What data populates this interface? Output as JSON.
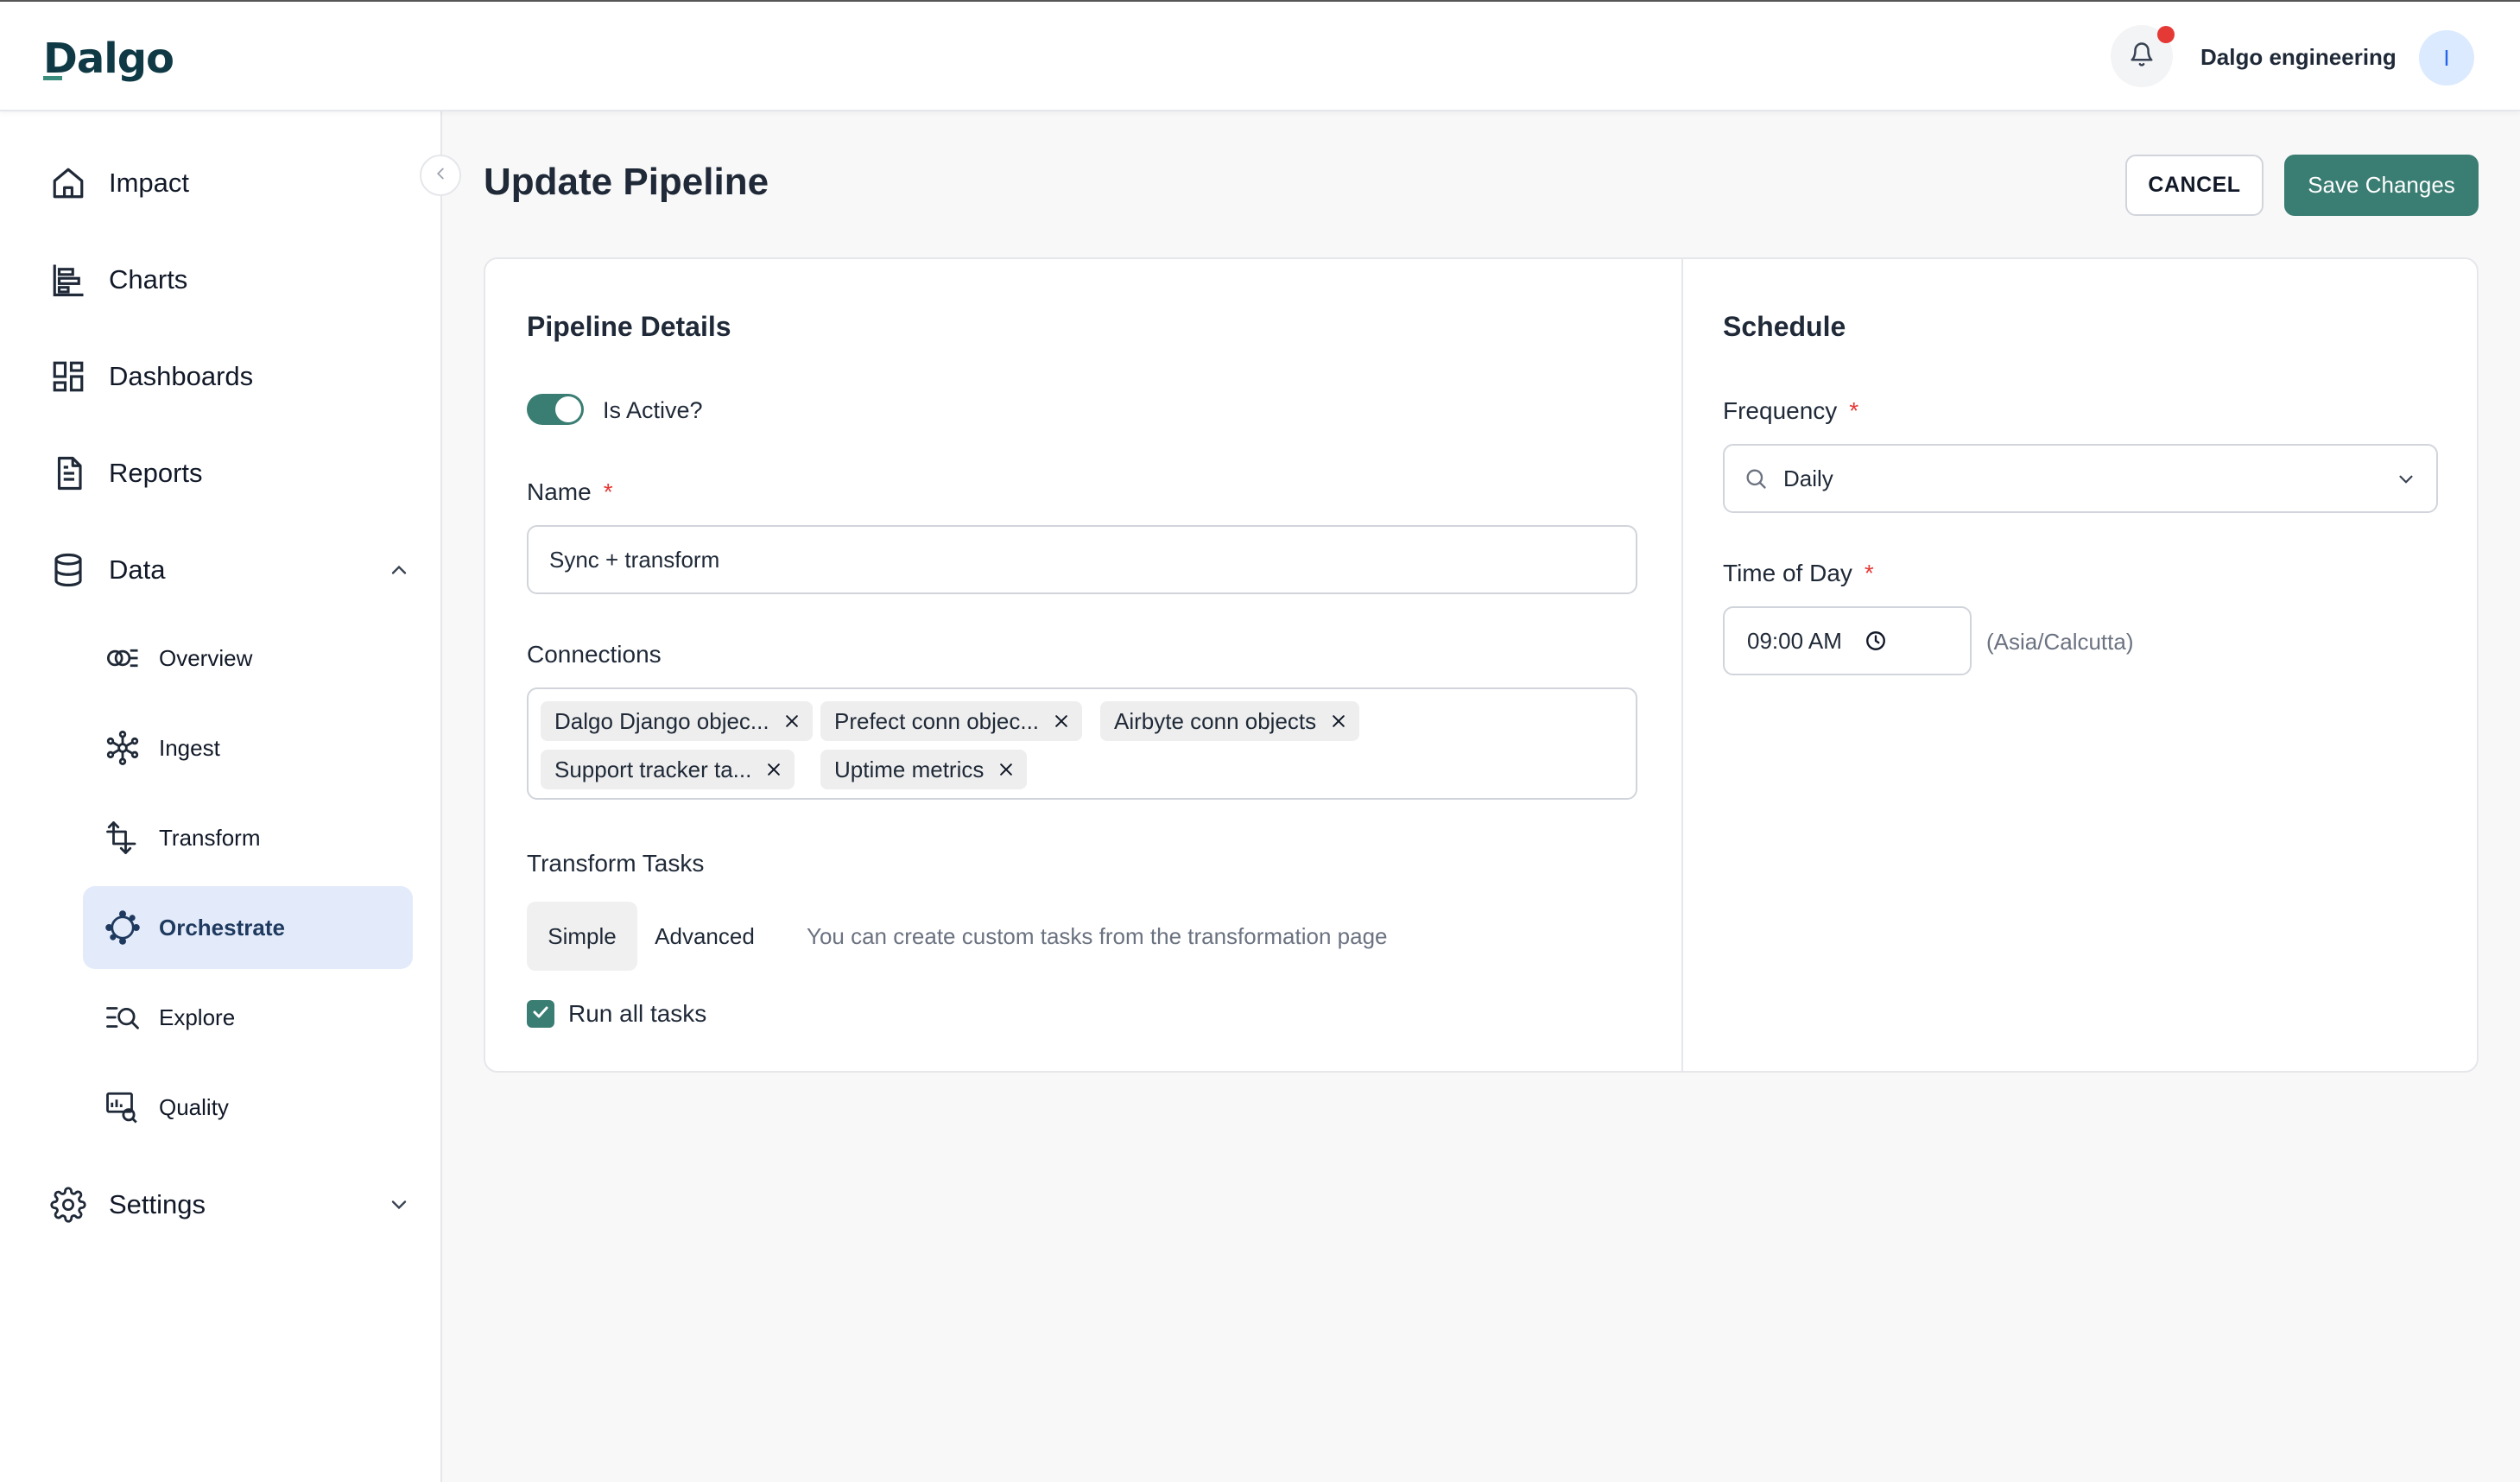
{
  "header": {
    "logo": "Dalgo",
    "org_name": "Dalgo engineering",
    "avatar_initial": "I",
    "icons": {
      "notifications": "bell-icon"
    }
  },
  "sidebar": {
    "items": [
      {
        "label": "Impact",
        "icon": "home-icon"
      },
      {
        "label": "Charts",
        "icon": "bar-chart-icon"
      },
      {
        "label": "Dashboards",
        "icon": "dashboard-grid-icon"
      },
      {
        "label": "Reports",
        "icon": "document-icon"
      },
      {
        "label": "Data",
        "icon": "database-icon",
        "expanded": true
      },
      {
        "label": "Settings",
        "icon": "gear-icon",
        "expanded": false
      }
    ],
    "data_subitems": [
      {
        "label": "Overview",
        "icon": "overview-icon"
      },
      {
        "label": "Ingest",
        "icon": "ingest-icon"
      },
      {
        "label": "Transform",
        "icon": "transform-icon"
      },
      {
        "label": "Orchestrate",
        "icon": "orchestrate-icon",
        "active": true
      },
      {
        "label": "Explore",
        "icon": "explore-icon"
      },
      {
        "label": "Quality",
        "icon": "quality-icon"
      }
    ]
  },
  "page": {
    "title": "Update Pipeline",
    "cancel_label": "CANCEL",
    "save_label": "Save Changes"
  },
  "pipeline_details": {
    "title": "Pipeline Details",
    "is_active_label": "Is Active?",
    "is_active": true,
    "name_label": "Name",
    "required_mark": "*",
    "name_value": "Sync + transform",
    "connections_label": "Connections",
    "connections": [
      "Dalgo Django objec...",
      "Prefect conn objec...",
      "Airbyte conn objects",
      "Support tracker ta...",
      "Uptime metrics"
    ],
    "transform_tasks_label": "Transform Tasks",
    "tabs": [
      "Simple",
      "Advanced"
    ],
    "active_tab": "Simple",
    "hint": "You can create custom tasks from the transformation page",
    "run_all_label": "Run all tasks",
    "run_all_checked": true
  },
  "schedule": {
    "title": "Schedule",
    "frequency_label": "Frequency",
    "frequency_value": "Daily",
    "time_label": "Time of Day",
    "time_value": "09:00 AM",
    "timezone": "(Asia/Calcutta)"
  },
  "colors": {
    "primary": "#3a7d73",
    "active_nav_bg": "#e3ebfb",
    "required": "#e53935",
    "notification_dot": "#e53935"
  }
}
